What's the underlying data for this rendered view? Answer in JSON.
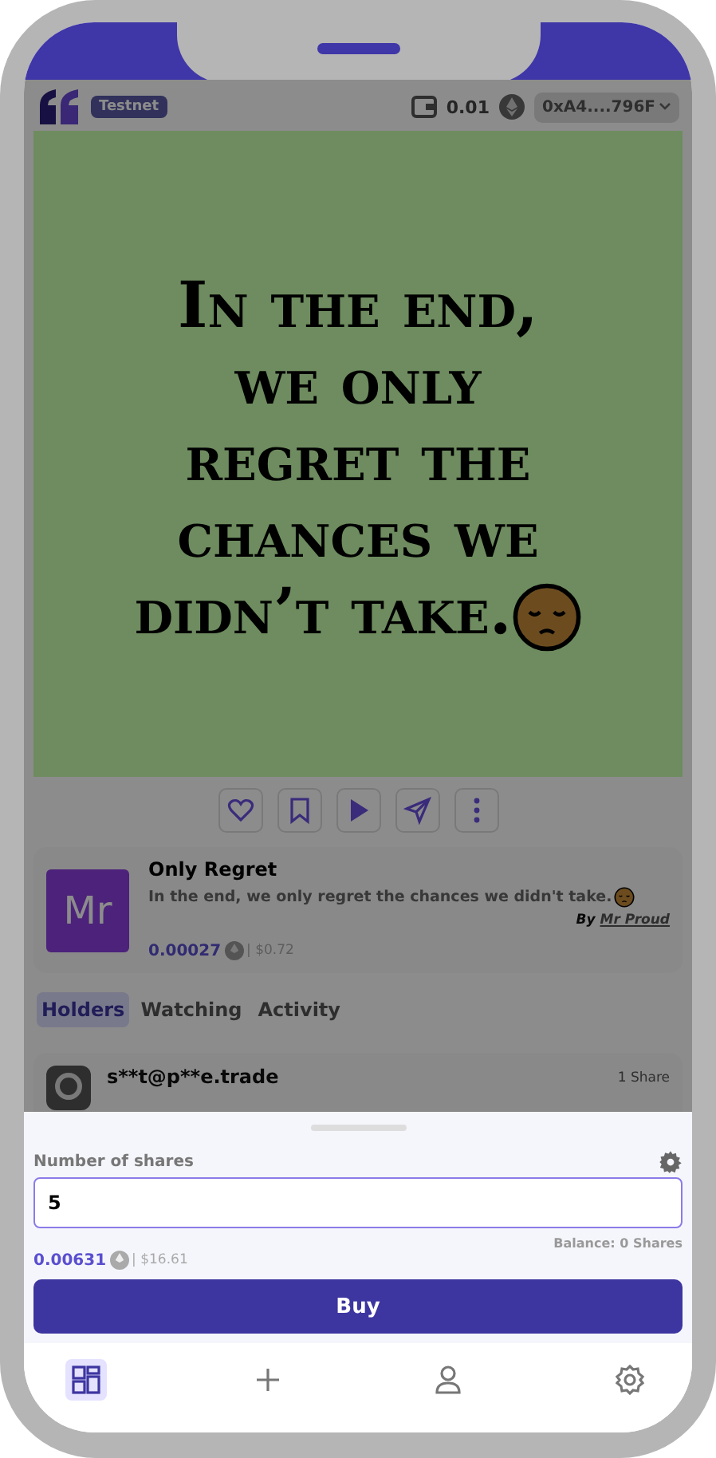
{
  "header": {
    "network_badge": "Testnet",
    "wallet_balance": "0.01",
    "address": "0xA4....796F"
  },
  "quote_image": {
    "text": "In the end, we only regret the chances we didn’t take."
  },
  "actions": [
    {
      "kind": "like"
    },
    {
      "kind": "bookmark"
    },
    {
      "kind": "play"
    },
    {
      "kind": "share"
    },
    {
      "kind": "more"
    }
  ],
  "item": {
    "avatar": "Mr",
    "title": "Only Regret",
    "description": "In the end, we only regret the chances we didn't take.",
    "by": "By",
    "author": "Mr Proud",
    "price": "0.00027",
    "usd": "| $0.72"
  },
  "tabs": [
    {
      "label": "Holders",
      "selected": true
    },
    {
      "label": "Watching",
      "selected": false
    },
    {
      "label": "Activity",
      "selected": false
    }
  ],
  "holders": [
    {
      "name": "s**t@p**e.trade",
      "shares": "1 Share"
    }
  ],
  "sheet": {
    "label": "Number of shares",
    "value": "5",
    "balance": "Balance: 0 Shares",
    "price": "0.00631",
    "usd": "| $16.61",
    "button": "Buy"
  },
  "nav": [
    {
      "kind": "dashboard",
      "selected": true
    },
    {
      "kind": "add",
      "selected": false
    },
    {
      "kind": "profile",
      "selected": false
    },
    {
      "kind": "settings",
      "selected": false
    }
  ]
}
